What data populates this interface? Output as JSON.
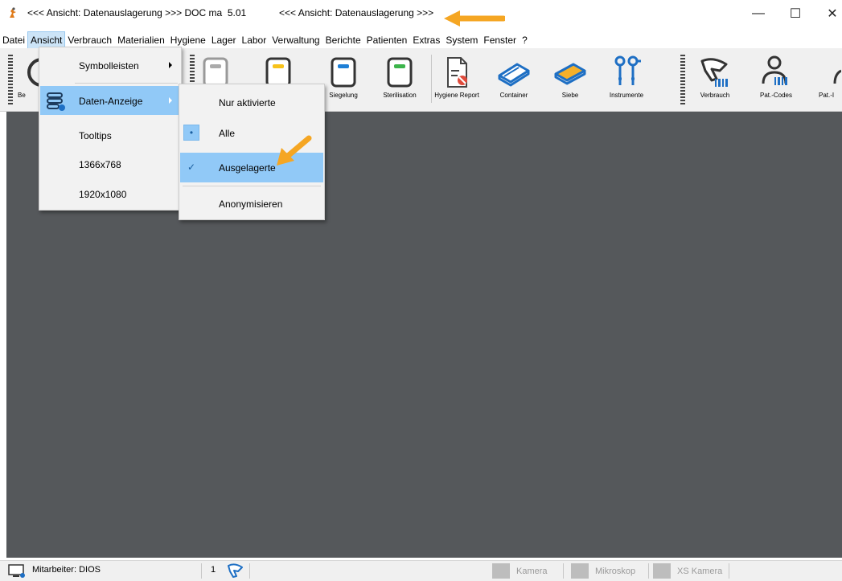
{
  "window": {
    "title": "<<< Ansicht: Datenauslagerung >>> DOC ma  5.01",
    "title_secondary": "<<< Ansicht: Datenauslagerung >>>",
    "controls": {
      "minimize": "—",
      "maximize": "☐",
      "close": "✕"
    }
  },
  "menubar": {
    "items": [
      {
        "label": "Datei"
      },
      {
        "label": "Ansicht",
        "active": true
      },
      {
        "label": "Verbrauch"
      },
      {
        "label": "Materialien"
      },
      {
        "label": "Hygiene"
      },
      {
        "label": "Lager"
      },
      {
        "label": "Labor"
      },
      {
        "label": "Verwaltung"
      },
      {
        "label": "Berichte"
      },
      {
        "label": "Patienten"
      },
      {
        "label": "Extras"
      },
      {
        "label": "System"
      },
      {
        "label": "Fenster"
      },
      {
        "label": "?"
      }
    ]
  },
  "toolbar": {
    "partial_left_label": "Be",
    "buttons": [
      {
        "label": "Siegelung",
        "icon": "sealing-icon"
      },
      {
        "label": "Sterilisation",
        "icon": "sterilisation-icon"
      },
      {
        "label": "Hygiene Report",
        "icon": "hygiene-report-icon"
      },
      {
        "label": "Container",
        "icon": "container-icon"
      },
      {
        "label": "Siebe",
        "icon": "tray-icon"
      },
      {
        "label": "Instrumente",
        "icon": "instruments-icon"
      },
      {
        "label": "Verbrauch",
        "icon": "barcode-scanner-icon"
      },
      {
        "label": "Pat.-Codes",
        "icon": "patient-codes-icon"
      },
      {
        "label": "Pat.-I",
        "icon": "patient-icon"
      }
    ]
  },
  "menu_ansicht": {
    "items": [
      {
        "label": "Symbolleisten",
        "submenu": true
      },
      {
        "label": "Daten-Anzeige",
        "submenu": true,
        "highlighted": true,
        "icon": "database-icon"
      },
      {
        "label": "Tooltips"
      },
      {
        "label": "1366x768"
      },
      {
        "label": "1920x1080"
      }
    ]
  },
  "menu_daten_anzeige": {
    "items": [
      {
        "label": "Nur aktivierte"
      },
      {
        "label": "Alle",
        "mark": "•"
      },
      {
        "label": "Ausgelagerte",
        "mark": "✓",
        "highlighted": true
      },
      {
        "label": "Anonymisieren"
      }
    ]
  },
  "statusbar": {
    "user": "Mitarbeiter: DIOS",
    "count": "1",
    "devices": [
      "Kamera",
      "Mikroskop",
      "XS Kamera"
    ]
  },
  "colors": {
    "main_background": "#55585b",
    "highlight": "#91c9f7",
    "annotation_arrow": "#f5a623"
  }
}
